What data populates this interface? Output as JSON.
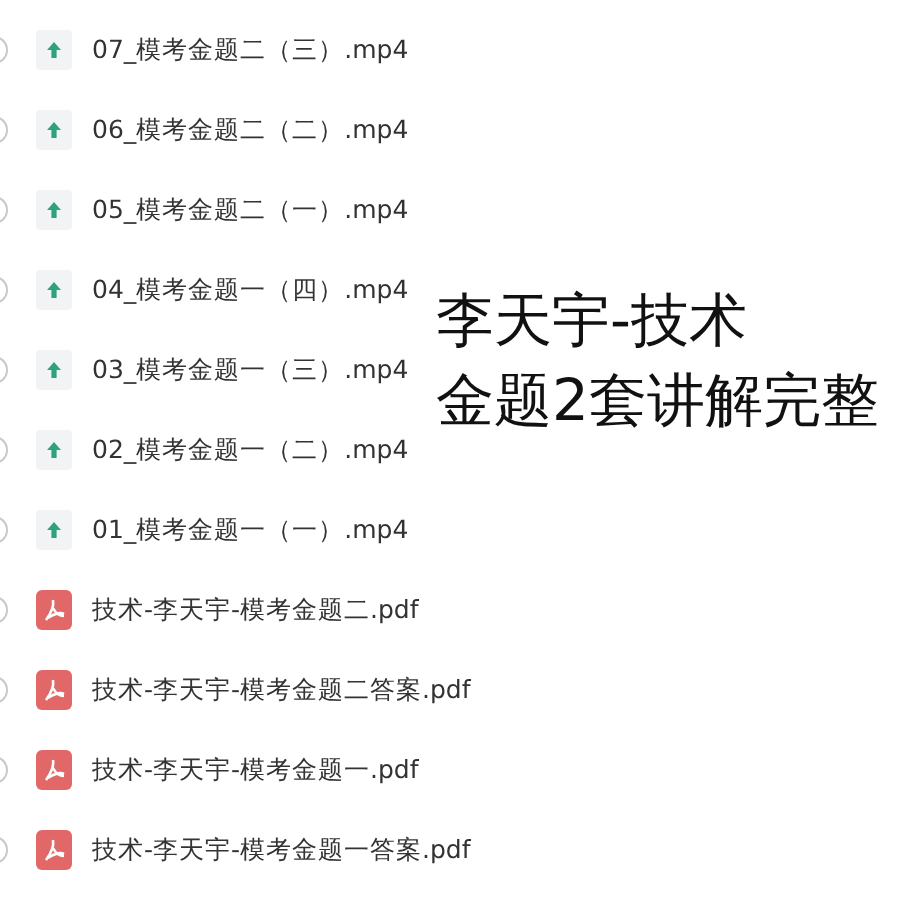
{
  "files": [
    {
      "kind": "video",
      "name": "07_模考金题二（三）.mp4",
      "checked": false
    },
    {
      "kind": "video",
      "name": "06_模考金题二（二）.mp4",
      "checked": false
    },
    {
      "kind": "video",
      "name": "05_模考金题二（一）.mp4",
      "checked": false
    },
    {
      "kind": "video",
      "name": "04_模考金题一（四）.mp4",
      "checked": false
    },
    {
      "kind": "video",
      "name": "03_模考金题一（三）.mp4",
      "checked": false
    },
    {
      "kind": "video",
      "name": "02_模考金题一（二）.mp4",
      "checked": false
    },
    {
      "kind": "video",
      "name": "01_模考金题一（一）.mp4",
      "checked": false
    },
    {
      "kind": "pdf",
      "name": "技术-李天宇-模考金题二.pdf",
      "checked": false
    },
    {
      "kind": "pdf",
      "name": "技术-李天宇-模考金题二答案.pdf",
      "checked": false
    },
    {
      "kind": "pdf",
      "name": "技术-李天宇-模考金题一.pdf",
      "checked": false
    },
    {
      "kind": "pdf",
      "name": "技术-李天宇-模考金题一答案.pdf",
      "checked": false
    }
  ],
  "caption": [
    "李天宇-技术",
    "金题2套讲解完整"
  ]
}
